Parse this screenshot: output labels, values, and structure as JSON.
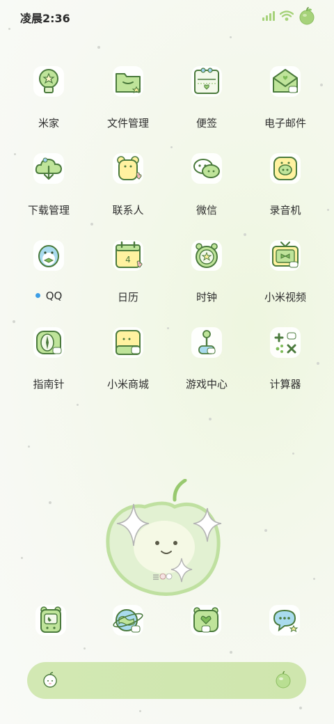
{
  "status_bar": {
    "time": "凌晨2:36",
    "signal_icon": "signal-bars-icon",
    "wifi_icon": "wifi-icon",
    "battery_icon": "apple-battery-icon"
  },
  "apps": [
    {
      "label": "米家",
      "icon": "lightbulb-icon"
    },
    {
      "label": "文件管理",
      "icon": "folder-icon"
    },
    {
      "label": "便签",
      "icon": "note-icon"
    },
    {
      "label": "电子邮件",
      "icon": "envelope-icon"
    },
    {
      "label": "下载管理",
      "icon": "download-cloud-icon"
    },
    {
      "label": "联系人",
      "icon": "contacts-bear-icon"
    },
    {
      "label": "微信",
      "icon": "chat-bubbles-icon"
    },
    {
      "label": "录音机",
      "icon": "recorder-icon"
    },
    {
      "label": "QQ",
      "icon": "penguin-icon",
      "has_notification_dot": true
    },
    {
      "label": "日历",
      "icon": "calendar-icon",
      "day": "4"
    },
    {
      "label": "时钟",
      "icon": "alarm-clock-icon"
    },
    {
      "label": "小米视频",
      "icon": "tv-icon"
    },
    {
      "label": "指南针",
      "icon": "compass-icon"
    },
    {
      "label": "小米商城",
      "icon": "shopping-bag-icon"
    },
    {
      "label": "游戏中心",
      "icon": "joystick-icon"
    },
    {
      "label": "计算器",
      "icon": "calculator-icon"
    }
  ],
  "widget": {
    "icon": "green-apple-sparkle-icon"
  },
  "dock": [
    {
      "icon": "phone-icon"
    },
    {
      "icon": "browser-globe-icon"
    },
    {
      "icon": "gallery-heart-icon"
    },
    {
      "icon": "messages-bubble-icon"
    }
  ],
  "search_bar": {
    "left_icon": "search-apple-icon",
    "right_icon": "apple-assistant-icon"
  },
  "colors": {
    "accent_green": "#a6d27a",
    "dark_outline": "#4a7a3c",
    "notification_blue": "#3d9ee6"
  }
}
